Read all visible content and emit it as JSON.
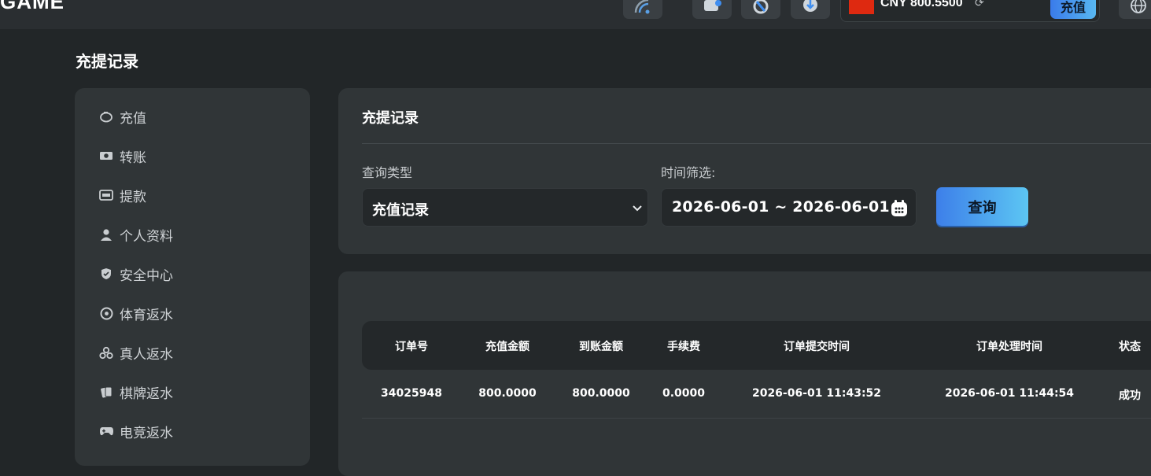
{
  "header": {
    "logo": "GAME",
    "currency": "CNY",
    "balance": "800.5500",
    "deposit_button": "充值",
    "icons": [
      "signal-icon",
      "wallet-icon",
      "support-icon",
      "download-icon",
      "refresh-icon",
      "globe-icon"
    ]
  },
  "page": {
    "title": "充提记录"
  },
  "sidebar": {
    "items": [
      {
        "label": "充值",
        "icon": "piggy-bank-icon"
      },
      {
        "label": "转账",
        "icon": "money-icon"
      },
      {
        "label": "提款",
        "icon": "cash-register-icon"
      },
      {
        "label": "个人资料",
        "icon": "user-icon"
      },
      {
        "label": "安全中心",
        "icon": "shield-icon"
      },
      {
        "label": "体育返水",
        "icon": "soccer-ball-icon"
      },
      {
        "label": "真人返水",
        "icon": "chips-icon"
      },
      {
        "label": "棋牌返水",
        "icon": "cards-icon"
      },
      {
        "label": "电竞返水",
        "icon": "gamepad-icon"
      }
    ]
  },
  "filters": {
    "title": "充提记录",
    "type_label": "查询类型",
    "type_value": "充值记录",
    "time_label": "时间筛选:",
    "date_range": "2026-06-01 ~ 2026-06-01",
    "query_button": "查询"
  },
  "table": {
    "headers": [
      "订单号",
      "充值金额",
      "到账金额",
      "手续费",
      "订单提交时间",
      "订单处理时间",
      "状态"
    ],
    "rows": [
      [
        "34025948",
        "800.0000",
        "800.0000",
        "0.0000",
        "2026-06-01 11:43:52",
        "2026-06-01 11:44:54",
        "成功"
      ]
    ]
  },
  "colors": {
    "accent_gradient_start": "#3d7fe9",
    "accent_gradient_end": "#5cc6f3",
    "background": "#222628",
    "panel": "#303537"
  }
}
